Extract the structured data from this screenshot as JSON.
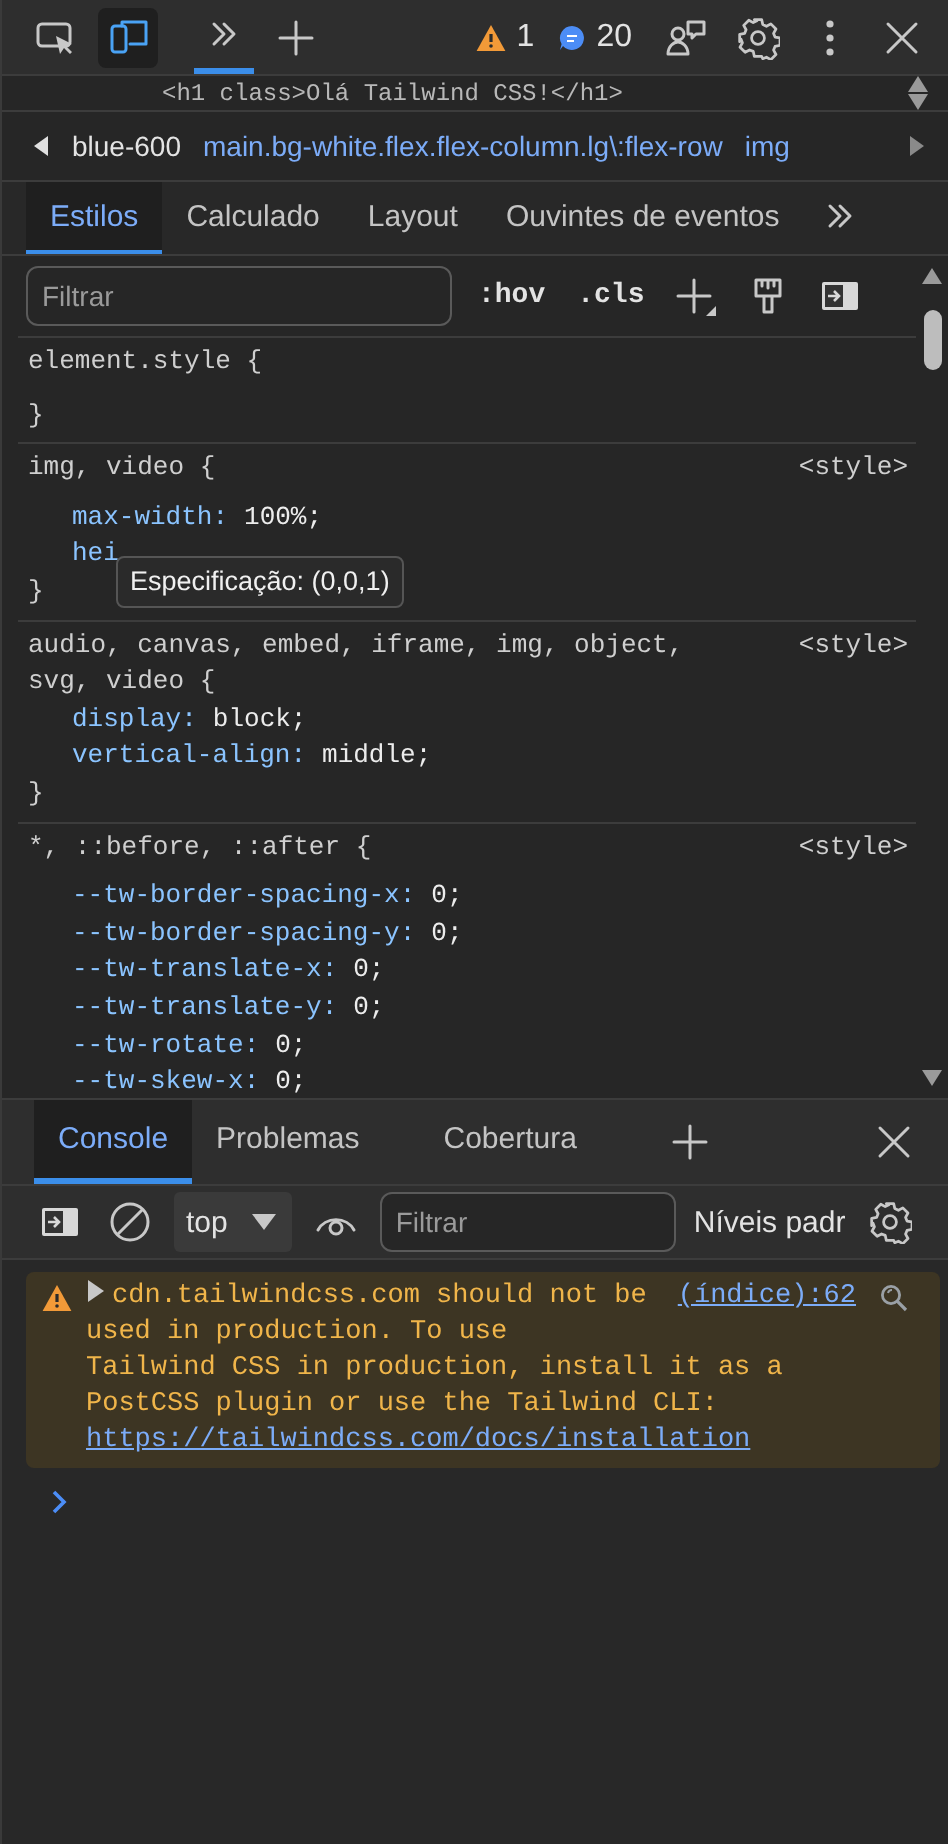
{
  "toolbar": {
    "toggles": [
      {
        "kind": "inspect",
        "on": false
      },
      {
        "kind": "device",
        "on": true
      }
    ],
    "panel_tabs": [
      {
        "kind": "overflow",
        "selected": true
      }
    ],
    "warning_count": "1",
    "message_count": "20"
  },
  "dom_line": "<h1 class>Olá Tailwind CSS!</h1>",
  "breadcrumbs": [
    "blue-600",
    "main.bg-white.flex.flex-column.lg\\:flex-row",
    "img"
  ],
  "styles_tabs": [
    {
      "label": "Estilos",
      "selected": true
    },
    {
      "label": "Calculado",
      "selected": false
    },
    {
      "label": "Layout",
      "selected": false
    },
    {
      "label": "Ouvintes de eventos",
      "selected": false
    }
  ],
  "styles_filter": {
    "placeholder": "Filtrar",
    "buttons": [
      ":hov",
      ".cls"
    ]
  },
  "rules": [
    {
      "selector": "element.style {",
      "close": "}"
    },
    {
      "selector": "img, video {",
      "source": "<style>",
      "properties": [
        {
          "name": "max-width:",
          "value": "100%;"
        },
        {
          "name": "hei"
        }
      ],
      "close": "}"
    },
    {
      "selector": "audio, canvas, embed, iframe, img, object, svg, video {",
      "source": "<style>",
      "properties": [
        {
          "name": "display:",
          "value": "block;"
        },
        {
          "name": "vertical-align:",
          "value": "middle;"
        }
      ],
      "close": "}"
    },
    {
      "selector": "*, ::before, ::after {",
      "source": "<style>",
      "properties": [
        {
          "name": "--tw-border-spacing-x:",
          "value": "0;"
        },
        {
          "name": "--tw-border-spacing-y:",
          "value": "0;"
        },
        {
          "name": "--tw-translate-x:",
          "value": "0;"
        },
        {
          "name": "--tw-translate-y:",
          "value": "0;"
        },
        {
          "name": "--tw-rotate:",
          "value": "0;"
        },
        {
          "name": "--tw-skew-x:",
          "value": "0;"
        }
      ]
    }
  ],
  "tooltip": "Especificação: (0,0,1)",
  "console_tabs": [
    {
      "label": "Console",
      "selected": true
    },
    {
      "label": "Problemas",
      "selected": false
    },
    {
      "label": "Cobertura",
      "selected": false
    }
  ],
  "console_toolbar": {
    "context": "top",
    "placeholder": "Filtrar",
    "levels": "Níveis padr"
  },
  "messages": [
    {
      "kind": "warning",
      "text": "cdn.tailwindcss.com should not be used in production. To use\nTailwind CSS in production, install it as a PostCSS plugin or use the Tailwind CLI: ",
      "link": "https://tailwindcss.com/docs/installation",
      "source": "(índice):62"
    }
  ]
}
